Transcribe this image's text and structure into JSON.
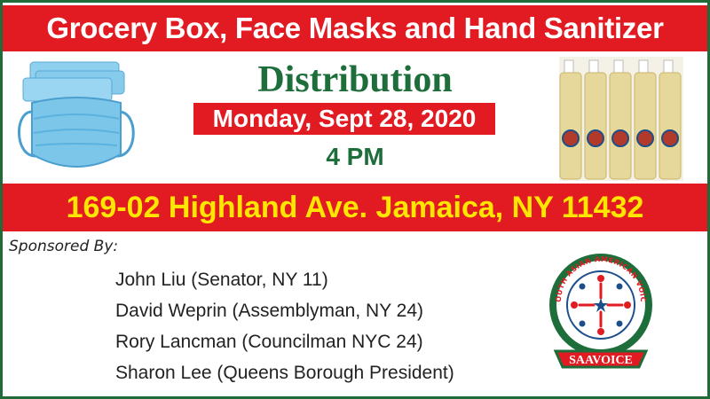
{
  "banner": {
    "title": "Grocery Box, Face Masks and Hand Sanitizer"
  },
  "event": {
    "heading": "Distribution",
    "date": "Monday, Sept 28, 2020",
    "time": "4 PM",
    "address": "169-02 Highland Ave. Jamaica, NY 11432"
  },
  "sponsors": {
    "label": "Sponsored By:",
    "items": [
      "John Liu (Senator, NY 11)",
      "David Weprin (Assemblyman, NY 24)",
      "Rory Lancman (Councilman NYC 24)",
      "Sharon Lee (Queens Borough President)"
    ]
  },
  "logo": {
    "ring_text": "SOUTH ASIAN AMERICAN VOICE",
    "banner_text": "SAAVOICE"
  },
  "images": {
    "left": "face-masks-image",
    "right": "hand-sanitizer-bottles-image"
  },
  "colors": {
    "red": "#e21b23",
    "green": "#1d6e3a",
    "yellow": "#ffe600",
    "mask_blue": "#7cc6ea"
  }
}
